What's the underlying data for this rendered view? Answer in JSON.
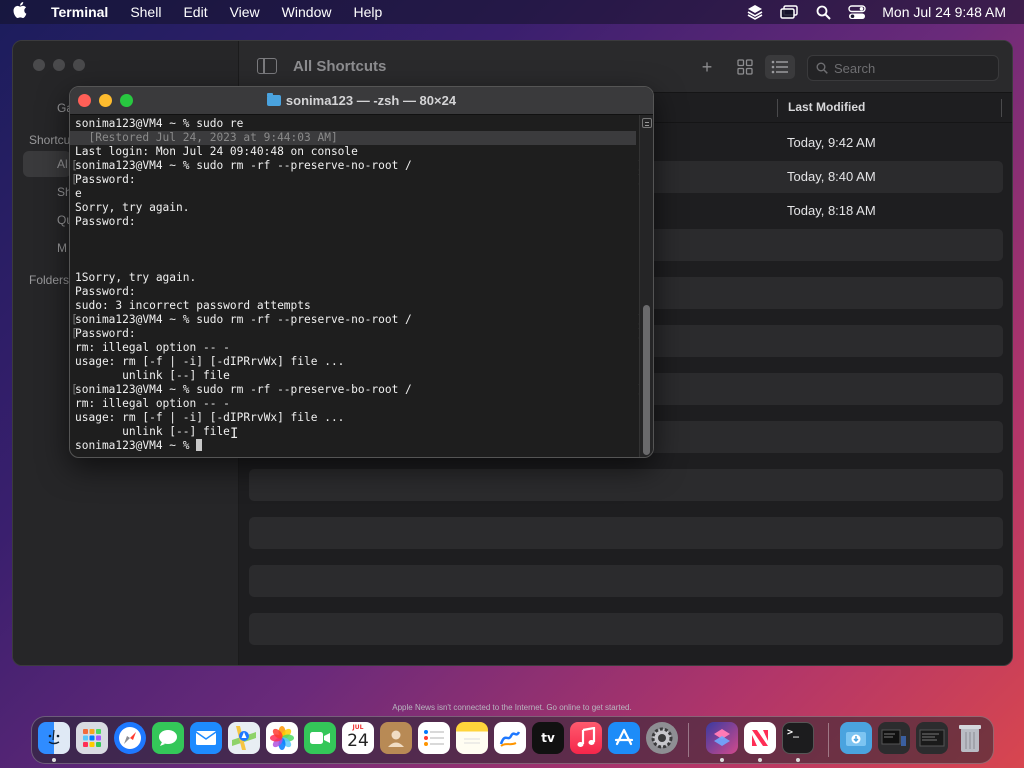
{
  "menubar": {
    "app_name": "Terminal",
    "items": [
      "Shell",
      "Edit",
      "View",
      "Window",
      "Help"
    ],
    "clock": "Mon Jul 24  9:48 AM"
  },
  "shortcuts": {
    "title": "All Shortcuts",
    "search_placeholder": "Search",
    "column_last_modified": "Last Modified",
    "sidebar_section_label": "Shortcu",
    "sidebar_folders_label": "Folders",
    "sidebar_partial": [
      "Ga",
      "Al",
      "Sh",
      "Qu",
      "M"
    ],
    "rows": [
      {
        "date": "Today, 9:42 AM"
      },
      {
        "date": "Today, 8:40 AM"
      },
      {
        "date": "Today, 8:18 AM"
      }
    ]
  },
  "terminal": {
    "title": "sonima123 — -zsh — 80×24",
    "lines": [
      "sonima123@VM4 ~ % sudo re",
      "  [Restored Jul 24, 2023 at 9:44:03 AM]",
      "Last login: Mon Jul 24 09:40:48 on console",
      "sonima123@VM4 ~ % sudo rm -rf --preserve-no-root /",
      "Password:",
      "e",
      "Sorry, try again.",
      "Password:",
      "",
      "",
      "",
      "1Sorry, try again.",
      "Password:",
      "sudo: 3 incorrect password attempts",
      "sonima123@VM4 ~ % sudo rm -rf --preserve-no-root /",
      "Password:",
      "rm: illegal option -- -",
      "usage: rm [-f | -i] [-dIPRrvWx] file ...",
      "       unlink [--] file",
      "sonima123@VM4 ~ % sudo rm -rf --preserve-bo-root /",
      "rm: illegal option -- -",
      "usage: rm [-f | -i] [-dIPRrvWx] file ...",
      "       unlink [--] file",
      "sonima123@VM4 ~ % "
    ]
  },
  "news_note": "Apple News isn't connected to the Internet. Go online to get started.",
  "dock": {
    "calendar_month": "JUL",
    "calendar_day": "24",
    "tv_label": "tv"
  }
}
